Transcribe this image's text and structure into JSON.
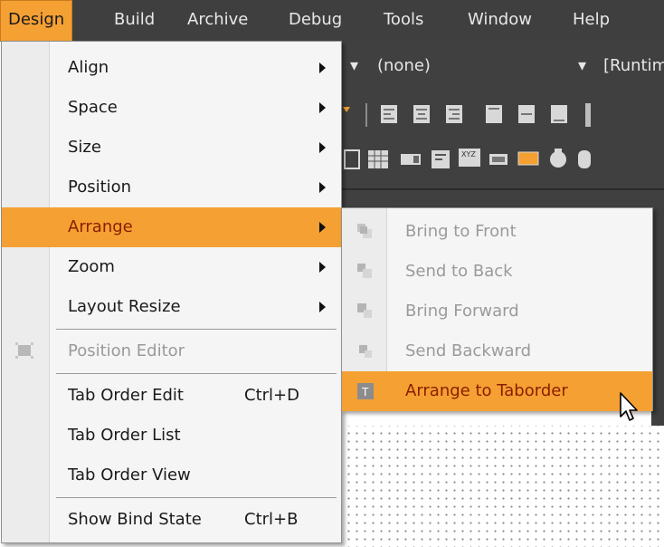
{
  "menubar": {
    "items": [
      {
        "label": "Design"
      },
      {
        "label": "Build"
      },
      {
        "label": "Archive"
      },
      {
        "label": "Debug"
      },
      {
        "label": "Tools"
      },
      {
        "label": "Window"
      },
      {
        "label": "Help"
      }
    ]
  },
  "toolbar": {
    "combo1_value": "(none)",
    "combo2_value": "[Runtim"
  },
  "design_menu": {
    "items": [
      {
        "label": "Align",
        "submenu": true
      },
      {
        "label": "Space",
        "submenu": true
      },
      {
        "label": "Size",
        "submenu": true
      },
      {
        "label": "Position",
        "submenu": true
      },
      {
        "label": "Arrange",
        "submenu": true,
        "highlighted": true
      },
      {
        "label": "Zoom",
        "submenu": true
      },
      {
        "label": "Layout Resize",
        "submenu": true
      },
      {
        "label": "Position Editor",
        "disabled": true,
        "icon": "position-editor-icon"
      },
      {
        "label": "Tab Order Edit",
        "shortcut": "Ctrl+D"
      },
      {
        "label": "Tab Order List"
      },
      {
        "label": "Tab Order View"
      },
      {
        "label": "Show Bind State",
        "shortcut": "Ctrl+B"
      }
    ]
  },
  "arrange_submenu": {
    "items": [
      {
        "label": "Bring to Front",
        "disabled": true,
        "icon": "bring-to-front-icon"
      },
      {
        "label": "Send to Back",
        "disabled": true,
        "icon": "send-to-back-icon"
      },
      {
        "label": "Bring Forward",
        "disabled": true,
        "icon": "bring-forward-icon"
      },
      {
        "label": "Send Backward",
        "disabled": true,
        "icon": "send-backward-icon"
      },
      {
        "label": "Arrange to Taborder",
        "highlighted": true,
        "icon": "taborder-icon"
      }
    ]
  },
  "colors": {
    "accent": "#f5a033",
    "menubar_bg": "#3f3f3f",
    "highlight_text": "#8a1f00",
    "disabled_text": "#9a9a9a"
  }
}
